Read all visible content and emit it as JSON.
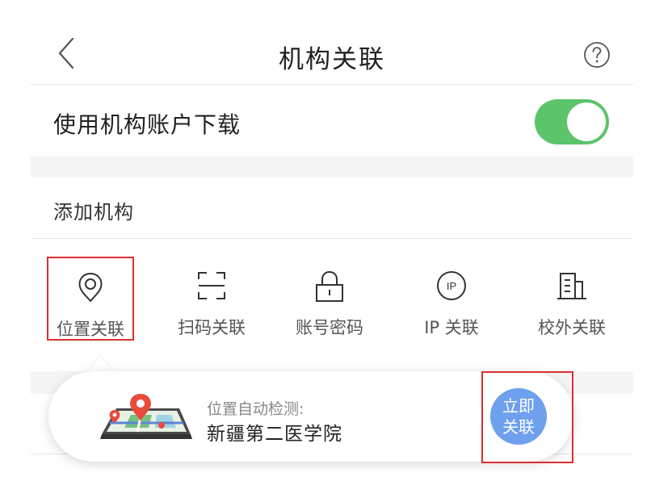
{
  "header": {
    "title": "机构关联",
    "back_icon": "chevron-left-icon",
    "help_icon": "question-circle-icon"
  },
  "settings": {
    "toggle_label": "使用机构账户下载",
    "toggle_on": true,
    "toggle_color": "#5cc46b"
  },
  "add_section": {
    "title": "添加机构",
    "options": [
      {
        "label": "位置关联",
        "icon": "location-pin-icon",
        "selected": true
      },
      {
        "label": "扫码关联",
        "icon": "scan-frame-icon"
      },
      {
        "label": "账号密码",
        "icon": "lock-icon"
      },
      {
        "label": "IP 关联",
        "icon": "ip-circle-icon"
      },
      {
        "label": "校外关联",
        "icon": "building-icon"
      }
    ]
  },
  "popup": {
    "caption": "位置自动检测:",
    "organization": "新疆第二医学院",
    "action_line1": "立即",
    "action_line2": "关联",
    "action_color": "#6fa0ee",
    "highlight_color": "#d93030"
  }
}
